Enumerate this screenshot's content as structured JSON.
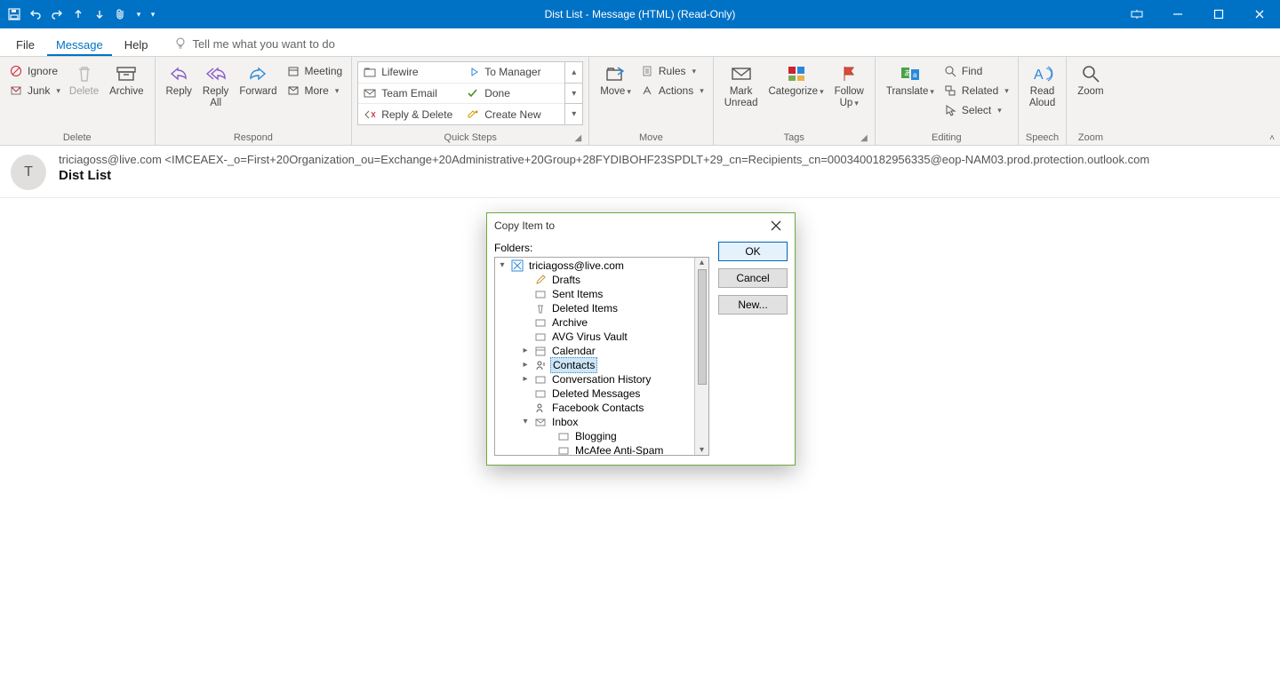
{
  "title": "Dist List  -  Message (HTML) (Read-Only)",
  "menu": {
    "file": "File",
    "message": "Message",
    "help": "Help",
    "tellme": "Tell me what you want to do"
  },
  "ribbon": {
    "delete": {
      "label": "Delete",
      "ignore": "Ignore",
      "junk": "Junk",
      "deleteBtn": "Delete",
      "archive": "Archive"
    },
    "respond": {
      "label": "Respond",
      "reply": "Reply",
      "replyAll": "Reply\nAll",
      "forward": "Forward",
      "meeting": "Meeting",
      "more": "More"
    },
    "quicksteps": {
      "label": "Quick Steps",
      "items": [
        "Lifewire",
        "Team Email",
        "Reply & Delete",
        "To Manager",
        "Done",
        "Create New"
      ]
    },
    "move": {
      "label": "Move",
      "moveBtn": "Move",
      "rules": "Rules",
      "actions": "Actions"
    },
    "tags": {
      "label": "Tags",
      "mark": "Mark\nUnread",
      "categorize": "Categorize",
      "follow": "Follow\nUp"
    },
    "editing": {
      "label": "Editing",
      "translate": "Translate",
      "find": "Find",
      "related": "Related",
      "select": "Select"
    },
    "speech": {
      "label": "Speech",
      "read": "Read\nAloud"
    },
    "zoom": {
      "label": "Zoom",
      "zoomBtn": "Zoom"
    }
  },
  "message": {
    "avatar": "T",
    "from": "triciagoss@live.com <IMCEAEX-_o=First+20Organization_ou=Exchange+20Administrative+20Group+28FYDIBOHF23SPDLT+29_cn=Recipients_cn=0003400182956335@eop-NAM03.prod.protection.outlook.com",
    "subject": "Dist List"
  },
  "dialog": {
    "title": "Copy Item to",
    "foldersLabel": "Folders:",
    "ok": "OK",
    "cancel": "Cancel",
    "new": "New...",
    "root": "triciagoss@live.com",
    "nodes": [
      "Drafts",
      "Sent Items",
      "Deleted Items",
      "Archive",
      "AVG Virus Vault",
      "Calendar",
      "Contacts",
      "Conversation History",
      "Deleted Messages",
      "Facebook Contacts",
      "Inbox"
    ],
    "inboxChildren": [
      "Blogging",
      "McAfee Anti-Spam"
    ]
  }
}
